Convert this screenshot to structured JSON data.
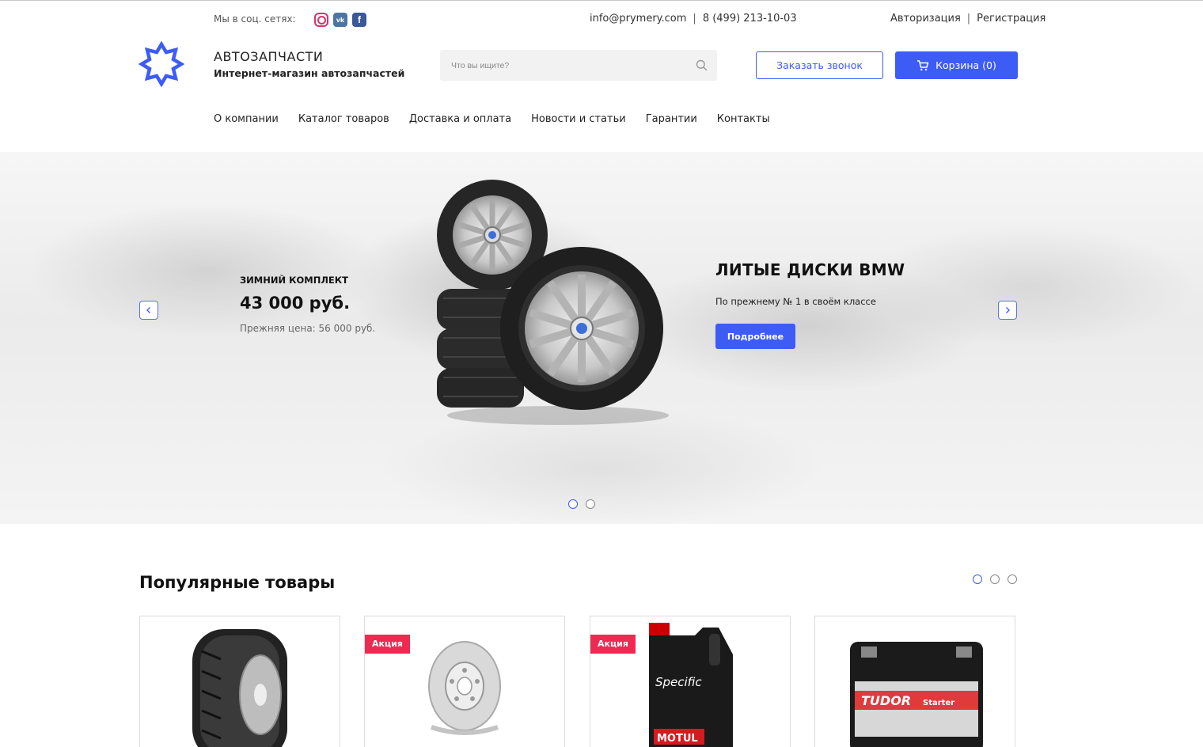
{
  "topbar": {
    "social_label": "Мы в соц. сетях:",
    "email": "info@prymery.com",
    "separator": "|",
    "phone": "8 (499) 213-10-03",
    "login": "Авторизация",
    "register": "Регистрация",
    "social_icons": [
      "instagram-icon",
      "vk-icon",
      "facebook-icon"
    ],
    "vk_glyph": "vk",
    "fb_glyph": "f"
  },
  "header": {
    "brand_title": "АВТОЗАПЧАСТИ",
    "brand_subtitle": "Интернет-магазин автозапчастей",
    "search_placeholder": "Что вы ищите?",
    "call_button": "Заказать звонок",
    "cart_button": "Корзина (0)"
  },
  "nav": [
    "О компании",
    "Каталог товаров",
    "Доставка и оплата",
    "Новости и статьи",
    "Гарантии",
    "Контакты"
  ],
  "banner": {
    "promo_label": "ЗИМНИЙ КОМПЛЕКТ",
    "promo_price": "43 000 руб.",
    "promo_old_price": "Прежняя цена: 56 000 руб.",
    "title": "ЛИТЫЕ ДИСКИ BMW",
    "subtitle": "По прежнему № 1 в своём классе",
    "button": "Подробнее",
    "slides_total": 2,
    "active_slide": 1
  },
  "popular": {
    "title": "Популярные товары",
    "pages_total": 3,
    "active_page": 1,
    "products": [
      {
        "image": "winter-tire",
        "badge": ""
      },
      {
        "image": "brake-disc",
        "badge": "Акция"
      },
      {
        "image": "motor-oil",
        "badge": "Акция"
      },
      {
        "image": "car-battery",
        "badge": ""
      }
    ],
    "oil_brand": "Specific",
    "oil_maker": "MOTUL",
    "battery_brand": "TUDOR",
    "battery_line": "Starter"
  },
  "colors": {
    "accent": "#3d5bf5",
    "badge": "#ee2a53",
    "text": "#222222"
  }
}
